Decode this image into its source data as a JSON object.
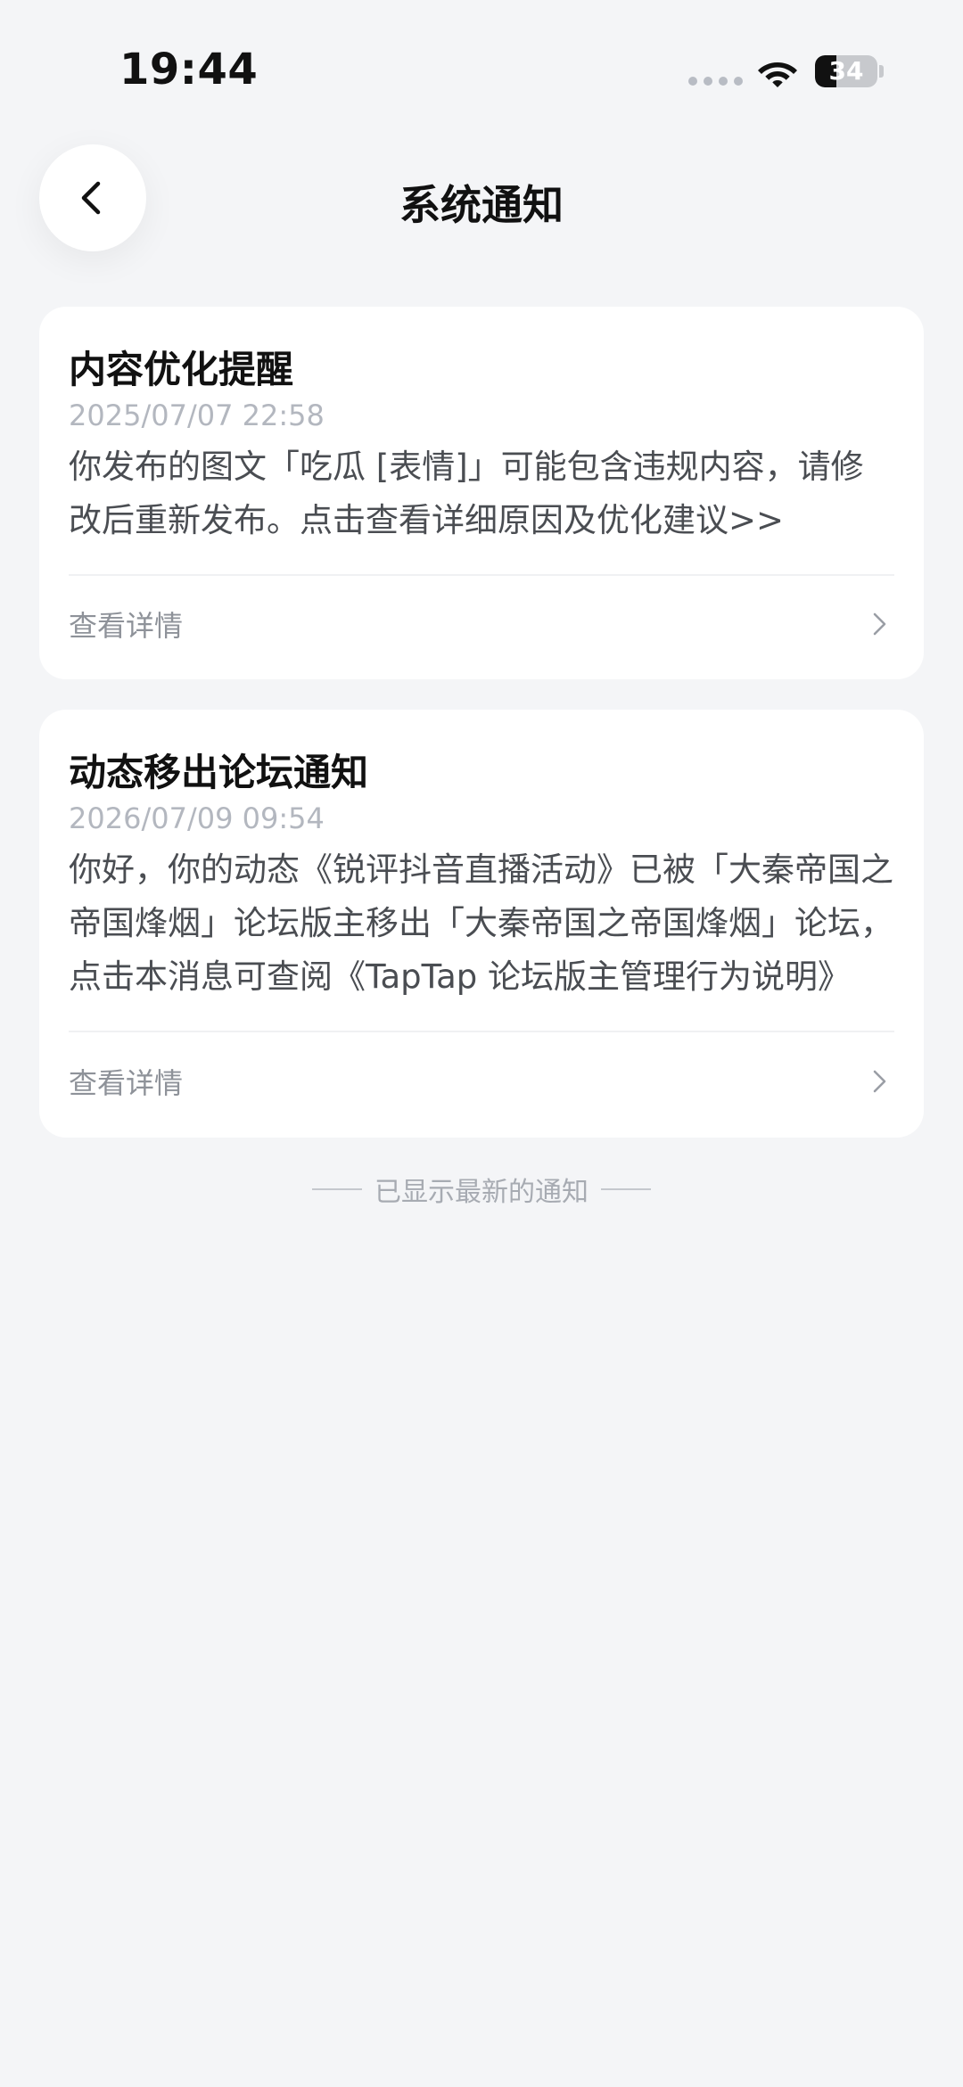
{
  "status_bar": {
    "time": "19:44",
    "battery_level": 34,
    "battery_text": "34"
  },
  "header": {
    "title": "系统通知",
    "back_icon": "chevron-left-icon"
  },
  "notifications": [
    {
      "title": "内容优化提醒",
      "date": "2025/07/07 22:58",
      "body": "你发布的图文「吃瓜 [表情]」可能包含违规内容，请修改后重新发布。点击查看详细原因及优化建议>>",
      "detail_label": "查看详情"
    },
    {
      "title": "动态移出论坛通知",
      "date": "2026/07/09 09:54",
      "body": "你好，你的动态《锐评抖音直播活动》已被「大秦帝国之帝国烽烟」论坛版主移出「大秦帝国之帝国烽烟」论坛，点击本消息可查阅《TapTap 论坛版主管理行为说明》",
      "detail_label": "查看详情"
    }
  ],
  "end_note": "已显示最新的通知"
}
